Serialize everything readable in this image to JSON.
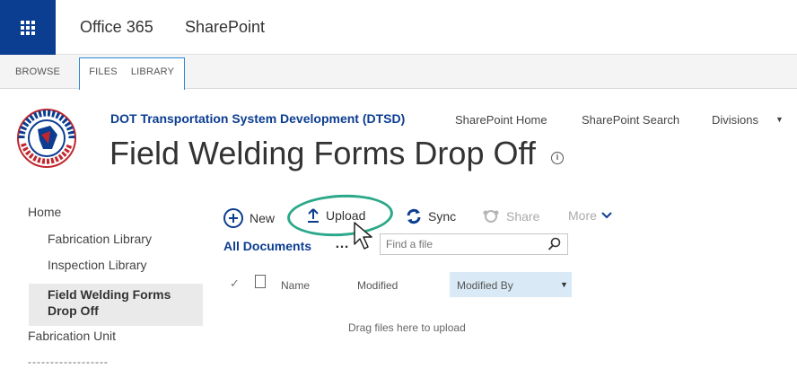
{
  "suite": {
    "app_launcher_icon": "waffle-icon",
    "office_label": "Office 365",
    "product_label": "SharePoint"
  },
  "ribbon": {
    "tabs": [
      "BROWSE",
      "FILES",
      "LIBRARY"
    ]
  },
  "header": {
    "logo": "wisconsin-dot-seal",
    "site_title": "DOT Transportation System Development (DTSD)",
    "page_title": "Field Welding Forms Drop Off",
    "top_nav": [
      "SharePoint Home",
      "SharePoint Search",
      "Divisions"
    ]
  },
  "left_nav": {
    "items": [
      {
        "label": "Home"
      },
      {
        "label": "Fabrication Library"
      },
      {
        "label": "Inspection Library"
      },
      {
        "label": "Field Welding Forms Drop Off",
        "selected": true
      },
      {
        "label": "Fabrication Unit"
      },
      {
        "label": "------------------"
      }
    ]
  },
  "commands": {
    "new": "New",
    "upload": "Upload",
    "sync": "Sync",
    "share": "Share",
    "more": "More"
  },
  "view": {
    "name": "All Documents",
    "ellipsis": "…",
    "search_placeholder": "Find a file"
  },
  "columns": [
    "Name",
    "Modified",
    "Modified By"
  ],
  "empty_text": "Drag files here to upload",
  "colors": {
    "accent": "#0b3d91",
    "highlight": "#2ba88a",
    "selected_column": "#d9e9f5"
  }
}
